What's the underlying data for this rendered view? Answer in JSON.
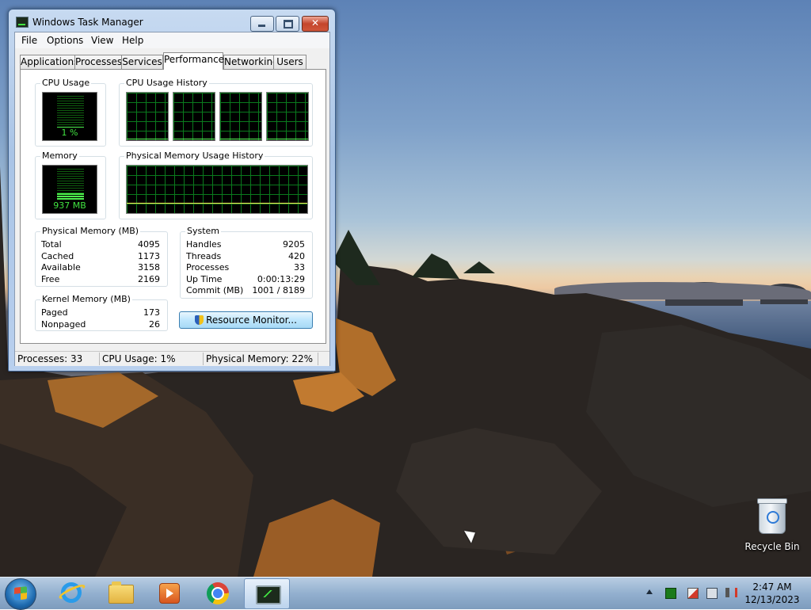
{
  "window": {
    "title": "Windows Task Manager",
    "menu": [
      "File",
      "Options",
      "View",
      "Help"
    ],
    "tabs": [
      "Applications",
      "Processes",
      "Services",
      "Performance",
      "Networking",
      "Users"
    ],
    "active_tab": "Performance"
  },
  "performance": {
    "cpu_usage": {
      "label": "CPU Usage",
      "value": "1 %",
      "level": 0.01
    },
    "cpu_history": {
      "label": "CPU Usage History",
      "cores": 4
    },
    "memory": {
      "label": "Memory",
      "value": "937 MB",
      "level": 0.22
    },
    "memory_history": {
      "label": "Physical Memory Usage History"
    },
    "physical_memory": {
      "label": "Physical Memory (MB)",
      "rows": [
        {
          "k": "Total",
          "v": "4095"
        },
        {
          "k": "Cached",
          "v": "1173"
        },
        {
          "k": "Available",
          "v": "3158"
        },
        {
          "k": "Free",
          "v": "2169"
        }
      ]
    },
    "kernel_memory": {
      "label": "Kernel Memory (MB)",
      "rows": [
        {
          "k": "Paged",
          "v": "173"
        },
        {
          "k": "Nonpaged",
          "v": "26"
        }
      ]
    },
    "system": {
      "label": "System",
      "rows": [
        {
          "k": "Handles",
          "v": "9205"
        },
        {
          "k": "Threads",
          "v": "420"
        },
        {
          "k": "Processes",
          "v": "33"
        },
        {
          "k": "Up Time",
          "v": "0:00:13:29"
        },
        {
          "k": "Commit (MB)",
          "v": "1001 / 8189"
        }
      ]
    },
    "resource_monitor_label": "Resource Monitor..."
  },
  "statusbar": {
    "processes": "Processes: 33",
    "cpu": "CPU Usage: 1%",
    "memory": "Physical Memory: 22%"
  },
  "desktop": {
    "recycle_bin_label": "Recycle Bin"
  },
  "taskbar": {
    "apps": [
      "internet-explorer",
      "windows-explorer",
      "windows-media-player",
      "google-chrome",
      "task-manager"
    ],
    "clock_time": "2:47 AM",
    "clock_date": "12/13/2023"
  },
  "colors": {
    "meter_green": "#41e341",
    "graph_grid": "#0a7a1d",
    "window_frame": "#a9c4e6",
    "close_red": "#c4452c"
  }
}
